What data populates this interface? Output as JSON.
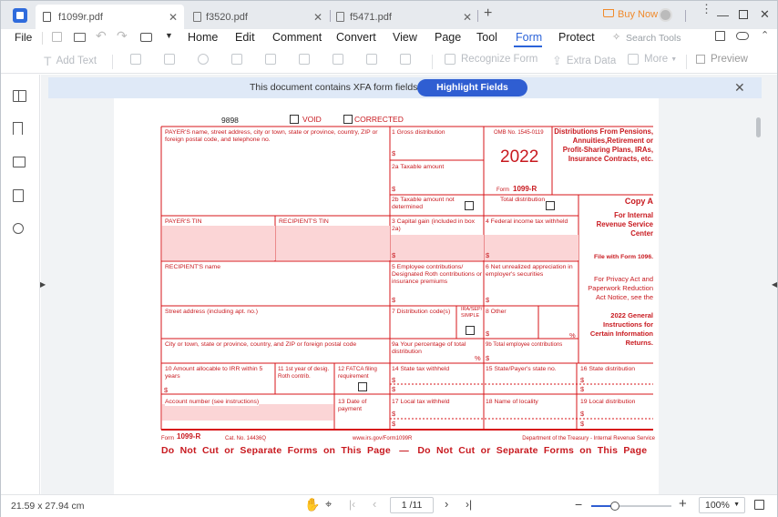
{
  "tabs": [
    {
      "label": "f1099r.pdf",
      "active": true
    },
    {
      "label": "f3520.pdf",
      "active": false
    },
    {
      "label": "f5471.pdf",
      "active": false
    }
  ],
  "window": {
    "buy_now": "Buy Now"
  },
  "menu": {
    "file": "File",
    "items": [
      "Home",
      "Edit",
      "Comment",
      "Convert",
      "View",
      "Page",
      "Tool",
      "Form",
      "Protect"
    ],
    "active": "Form",
    "search_placeholder": "Search Tools"
  },
  "toolbar": {
    "add_text": "Add Text",
    "recognize_form": "Recognize Form",
    "extra_data": "Extra Data",
    "more": "More",
    "preview": "Preview"
  },
  "xfa": {
    "message": "This document contains XFA form fields.",
    "button": "Highlight Fields"
  },
  "form": {
    "corrected_code": "9898",
    "void_label": "VOID",
    "corrected_label": "CORRECTED",
    "payer_name_label": "PAYER'S name, street address, city or town, state or province, country, ZIP or foreign postal code, and telephone no.",
    "box1": "1  Gross distribution",
    "omb": "OMB No. 1545-0119",
    "year": "2022",
    "form_label": "Form",
    "form_number": "1099-R",
    "title": "Distributions From Pensions, Annuities,Retirement or Profit-Sharing Plans, IRAs, Insurance Contracts, etc.",
    "box2a": "2a  Taxable amount",
    "box2b": "2b  Taxable amount not determined",
    "total_distribution": "Total distribution",
    "copy_a": "Copy A",
    "copy_a_for": "For Internal Revenue Service Center",
    "file_with": "File with Form 1096.",
    "payer_tin": "PAYER'S TIN",
    "recipient_tin": "RECIPIENT'S TIN",
    "box3": "3  Capital gain (included in box 2a)",
    "box4": "4  Federal income tax withheld",
    "recipient_name": "RECIPIENT'S name",
    "box5": "5  Employee contributions/ Designated Roth contributions or insurance premiums",
    "box6": "6  Net unrealized appreciation in employer's securities",
    "privacy": "For Privacy Act and Paperwork Reduction Act Notice, see the",
    "privacy_bold": "2022 General Instructions for Certain Information Returns.",
    "street": "Street address (including apt. no.)",
    "box7": "7  Distribution code(s)",
    "ira": "IRA/SEP/ SIMPLE",
    "box8": "8  Other",
    "city": "City or town, state or province, country, and ZIP or foreign postal code",
    "box9a": "9a  Your percentage of total distribution",
    "box9b": "9b  Total employee contributions",
    "box10": "10  Amount allocable to IRR within 5 years",
    "box11": "11  1st year of desig. Roth contrib.",
    "box12": "12  FATCA filing requirement",
    "box14": "14  State tax withheld",
    "box15": "15  State/Payer's state no.",
    "box16": "16  State distribution",
    "account": "Account number (see instructions)",
    "box13": "13  Date of payment",
    "box17": "17  Local tax withheld",
    "box18": "18  Name of locality",
    "box19": "19  Local distribution",
    "footer_form": "Form",
    "footer_num": "1099-R",
    "cat": "Cat. No. 14436Q",
    "url": "www.irs.gov/Form1099R",
    "dept": "Department of the Treasury - Internal Revenue Service",
    "do_not_cut": "Do  Not  Cut  or  Separate  Forms  on  This  Page   —   Do  Not  Cut  or  Separate  Forms  on  This  Page",
    "dollar": "$",
    "pct": "%"
  },
  "status": {
    "dimensions": "21.59 x 27.94 cm",
    "page": "1 /11",
    "zoom": "100%",
    "zoom_level": 0.3
  }
}
